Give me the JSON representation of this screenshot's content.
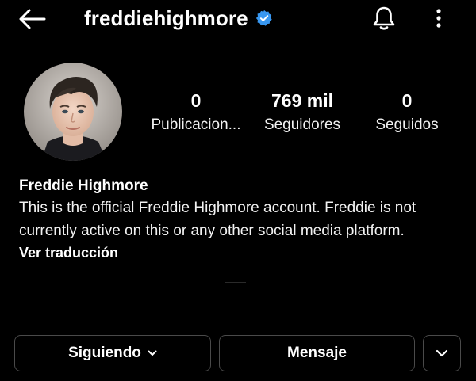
{
  "header": {
    "back_icon": "arrow-left-icon",
    "username": "freddiehighmore",
    "verified_icon": "verified-badge-icon",
    "bell_icon": "bell-icon",
    "more_icon": "more-vertical-icon"
  },
  "profile": {
    "avatar_icon": "profile-photo",
    "stats": [
      {
        "value": "0",
        "label": "Publicacion..."
      },
      {
        "value": "769 mil",
        "label": "Seguidores"
      },
      {
        "value": "0",
        "label": "Seguidos"
      }
    ]
  },
  "bio": {
    "name": "Freddie Highmore",
    "text_line1": "This is the official Freddie Highmore account. Freddie is not",
    "text_line2": "currently active on this or any other social media platform.",
    "translate": "Ver traducción"
  },
  "actions": {
    "following_label": "Siguiendo",
    "message_label": "Mensaje",
    "dropdown_icon": "chevron-down-icon"
  },
  "colors": {
    "background": "#000000",
    "text": "#ffffff",
    "verified": "#3897f0",
    "button_border": "#4a4a4a"
  }
}
